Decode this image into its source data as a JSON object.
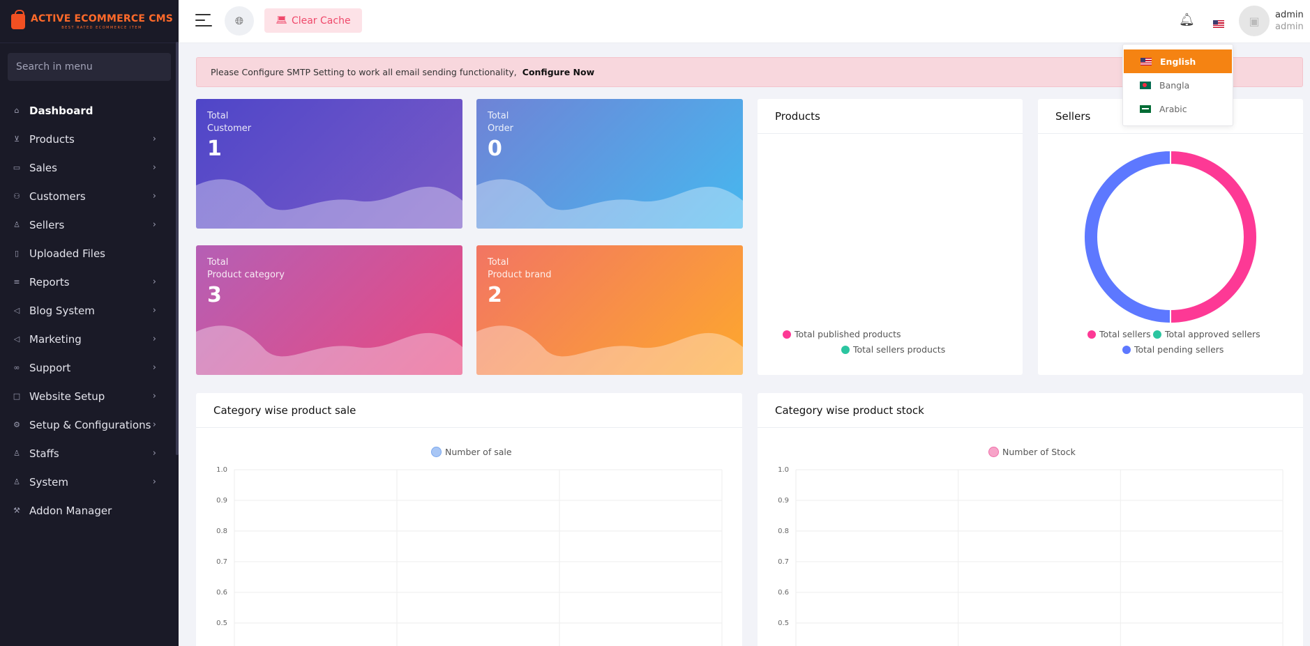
{
  "brand": {
    "title_part1": "ACTIVE",
    "title_part2": "ECOMMERCE CMS",
    "subtitle": "BEST RATED ECOMMERCE ITEM"
  },
  "sidebar": {
    "search_placeholder": "Search in menu",
    "items": [
      {
        "label": "Dashboard",
        "icon": "home-icon",
        "has_chevron": false,
        "active": true
      },
      {
        "label": "Products",
        "icon": "cart-icon",
        "has_chevron": true
      },
      {
        "label": "Sales",
        "icon": "money-icon",
        "has_chevron": true
      },
      {
        "label": "Customers",
        "icon": "users-icon",
        "has_chevron": true
      },
      {
        "label": "Sellers",
        "icon": "user-icon",
        "has_chevron": true
      },
      {
        "label": "Uploaded Files",
        "icon": "folder-icon",
        "has_chevron": false
      },
      {
        "label": "Reports",
        "icon": "file-icon",
        "has_chevron": true
      },
      {
        "label": "Blog System",
        "icon": "bullhorn-icon",
        "has_chevron": true
      },
      {
        "label": "Marketing",
        "icon": "bullhorn-icon",
        "has_chevron": true
      },
      {
        "label": "Support",
        "icon": "link-icon",
        "has_chevron": true
      },
      {
        "label": "Website Setup",
        "icon": "desktop-icon",
        "has_chevron": true
      },
      {
        "label": "Setup & Configurations",
        "icon": "gear-icon",
        "has_chevron": true
      },
      {
        "label": "Staffs",
        "icon": "user-icon",
        "has_chevron": true
      },
      {
        "label": "System",
        "icon": "user-icon",
        "has_chevron": true
      },
      {
        "label": "Addon Manager",
        "icon": "wrench-icon",
        "has_chevron": false
      }
    ]
  },
  "topbar": {
    "clear_cache_label": "Clear Cache",
    "user": {
      "name": "admin",
      "role": "admin"
    }
  },
  "alert": {
    "message": "Please Configure SMTP Setting to work all email sending functionality,",
    "link": "Configure Now"
  },
  "stats": [
    {
      "label_line1": "Total",
      "label_line2": "Customer",
      "value": "1"
    },
    {
      "label_line1": "Total",
      "label_line2": "Order",
      "value": "0"
    },
    {
      "label_line1": "Total",
      "label_line2": "Product category",
      "value": "3"
    },
    {
      "label_line1": "Total",
      "label_line2": "Product brand",
      "value": "2"
    }
  ],
  "products_panel": {
    "title": "Products",
    "legend": [
      {
        "label": "Total published products",
        "color": "#fd3995"
      },
      {
        "label": "Total sellers products",
        "color": "#2bc5a0"
      }
    ]
  },
  "sellers_panel": {
    "title": "Sellers",
    "legend": [
      {
        "label": "Total sellers",
        "color": "#fd3995"
      },
      {
        "label": "Total approved sellers",
        "color": "#2bc5a0"
      },
      {
        "label": "Total pending sellers",
        "color": "#5d78ff"
      }
    ]
  },
  "category_sale_panel": {
    "title": "Category wise product sale",
    "legend": "Number of sale",
    "legend_color": "#a8c6f5"
  },
  "category_stock_panel": {
    "title": "Category wise product stock",
    "legend": "Number of Stock",
    "legend_color": "#f7a3c8"
  },
  "languages": [
    {
      "label": "English",
      "flag": "us",
      "selected": true
    },
    {
      "label": "Bangla",
      "flag": "bd",
      "selected": false
    },
    {
      "label": "Arabic",
      "flag": "sa",
      "selected": false
    }
  ],
  "chart_data": [
    {
      "type": "pie",
      "title": "Sellers",
      "categories": [
        "Total sellers",
        "Total approved sellers",
        "Total pending sellers"
      ],
      "values": [
        1,
        0,
        1
      ],
      "colors": [
        "#fd3995",
        "#2bc5a0",
        "#5d78ff"
      ],
      "legend": "bottom"
    },
    {
      "type": "bar",
      "title": "Category wise product sale",
      "series": [
        {
          "name": "Number of sale",
          "values": []
        }
      ],
      "categories": [],
      "ylim": [
        0,
        1.0
      ],
      "yticks": [
        "1.0",
        "0.9",
        "0.8",
        "0.7",
        "0.6",
        "0.5"
      ],
      "grid": true,
      "legend": "top"
    },
    {
      "type": "bar",
      "title": "Category wise product stock",
      "series": [
        {
          "name": "Number of Stock",
          "values": []
        }
      ],
      "categories": [],
      "ylim": [
        0,
        1.0
      ],
      "yticks": [
        "1.0",
        "0.9",
        "0.8",
        "0.7",
        "0.6",
        "0.5"
      ],
      "grid": true,
      "legend": "top"
    }
  ]
}
